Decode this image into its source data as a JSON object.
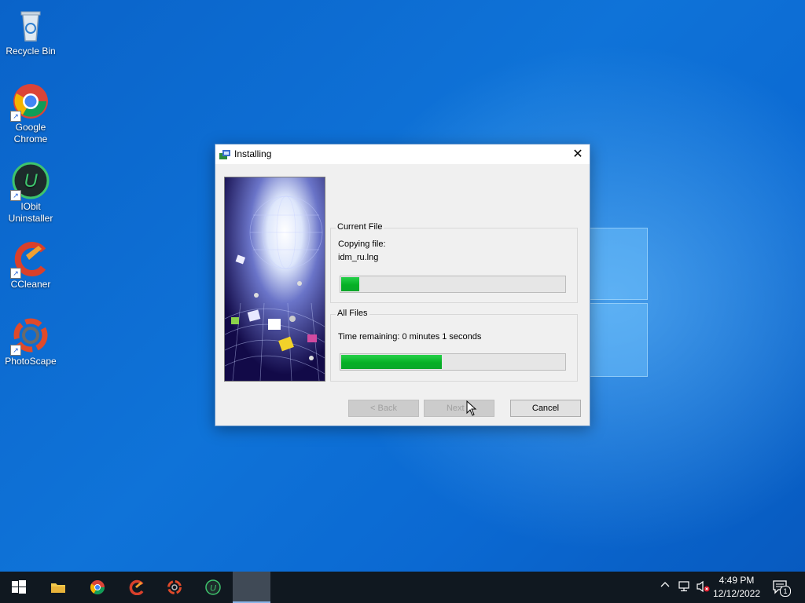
{
  "desktop": {
    "icons": [
      {
        "label": "Recycle Bin",
        "icon": "recycle-bin-icon"
      },
      {
        "label": "Google Chrome",
        "icon": "chrome-icon"
      },
      {
        "label": "IObit Uninstaller",
        "icon": "iobit-uninstaller-icon"
      },
      {
        "label": "CCleaner",
        "icon": "ccleaner-icon"
      },
      {
        "label": "PhotoScape",
        "icon": "photoscape-icon"
      }
    ]
  },
  "dialog": {
    "title": "Installing",
    "close_label": "✕",
    "current_file": {
      "group_label": "Current File",
      "status": "Copying file:",
      "filename": "idm_ru.lng",
      "progress": 0.08
    },
    "all_files": {
      "group_label": "All Files",
      "time_remaining": "Time remaining: 0 minutes 1 seconds",
      "progress": 0.45
    },
    "buttons": {
      "back": "< Back",
      "next": "Next >",
      "cancel": "Cancel"
    }
  },
  "taskbar": {
    "clock_time": "4:49 PM",
    "clock_date": "12/12/2022",
    "notification_count": "1",
    "items": [
      "start-icon",
      "file-explorer-icon",
      "chrome-icon",
      "ccleaner-icon",
      "photoscape-icon",
      "iobit-uninstaller-icon",
      "installer-window"
    ]
  },
  "colors": {
    "progress_green": "#06b025",
    "desktop_blue": "#0f73d8"
  }
}
